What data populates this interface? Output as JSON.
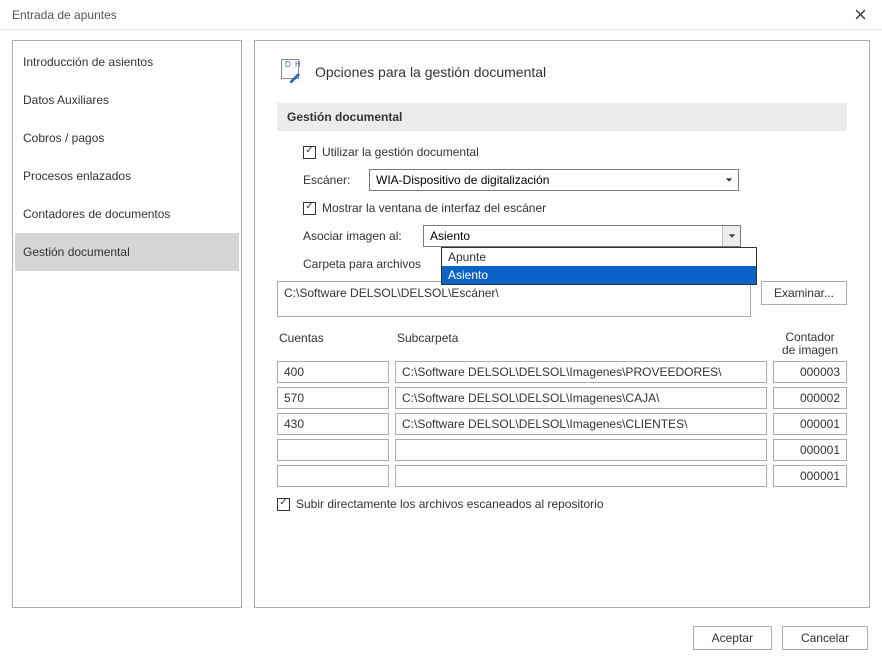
{
  "window": {
    "title": "Entrada de apuntes"
  },
  "sidebar": {
    "items": [
      {
        "label": "Introducción de asientos"
      },
      {
        "label": "Datos Auxiliares"
      },
      {
        "label": "Cobros / pagos"
      },
      {
        "label": "Procesos enlazados"
      },
      {
        "label": "Contadores de documentos"
      },
      {
        "label": "Gestión documental"
      }
    ],
    "active_index": 5
  },
  "panel": {
    "title": "Opciones para la gestión documental",
    "group": "Gestión documental",
    "use_gestion": {
      "label": "Utilizar la gestión documental",
      "checked": true
    },
    "scanner": {
      "label": "Escáner:",
      "value": "WIA-Dispositivo de digitalización"
    },
    "show_scanner_ui": {
      "label": "Mostrar la ventana de interfaz del escáner",
      "checked": true
    },
    "asociar": {
      "label": "Asociar imagen al:",
      "value": "Asiento",
      "options": [
        "Apunte",
        "Asiento"
      ],
      "open": true,
      "selected_index": 1
    },
    "carpeta": {
      "label": "Carpeta para archivos",
      "value": "C:\\Software DELSOL\\DELSOL\\Escáner\\"
    },
    "examinar": "Examinar...",
    "table": {
      "headers": {
        "cuentas": "Cuentas",
        "subcarpeta": "Subcarpeta",
        "contador_l1": "Contador",
        "contador_l2": "de imagen"
      },
      "rows": [
        {
          "cuentas": "400",
          "subcarpeta": "C:\\Software DELSOL\\DELSOL\\Imagenes\\PROVEEDORES\\",
          "contador": "000003"
        },
        {
          "cuentas": "570",
          "subcarpeta": "C:\\Software DELSOL\\DELSOL\\Imagenes\\CAJA\\",
          "contador": "000002"
        },
        {
          "cuentas": "430",
          "subcarpeta": "C:\\Software DELSOL\\DELSOL\\Imagenes\\CLIENTES\\",
          "contador": "000001"
        },
        {
          "cuentas": "",
          "subcarpeta": "",
          "contador": "000001"
        },
        {
          "cuentas": "",
          "subcarpeta": "",
          "contador": "000001"
        }
      ]
    },
    "subir_repo": {
      "label": "Subir directamente los archivos escaneados al repositorio",
      "checked": true
    }
  },
  "footer": {
    "accept": "Aceptar",
    "cancel": "Cancelar"
  }
}
